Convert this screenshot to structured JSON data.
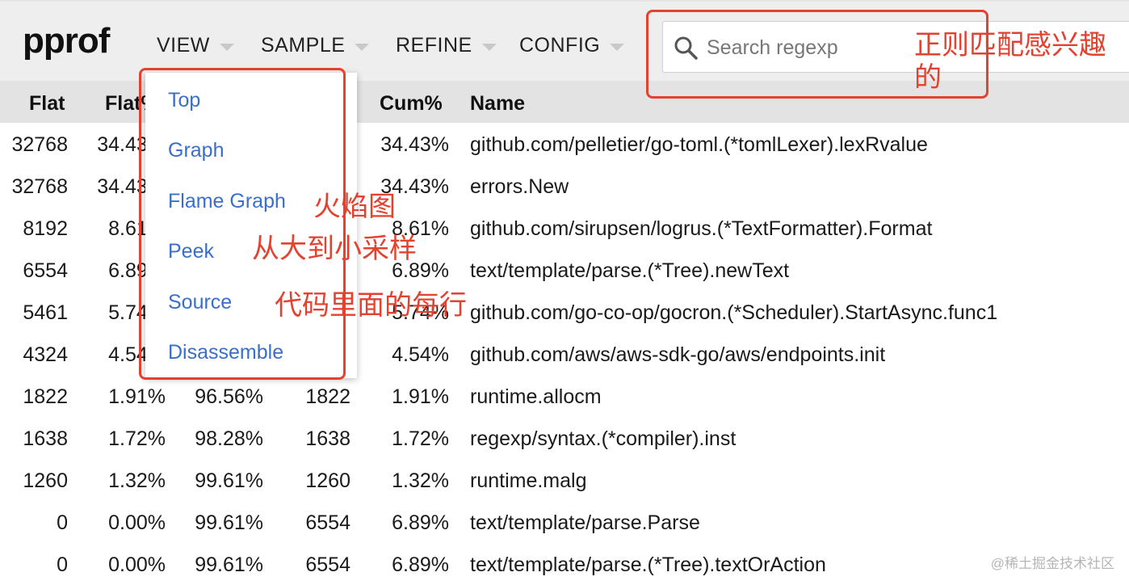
{
  "app": {
    "logo": "pprof"
  },
  "menus": [
    {
      "label": "VIEW"
    },
    {
      "label": "SAMPLE"
    },
    {
      "label": "REFINE"
    },
    {
      "label": "CONFIG"
    }
  ],
  "search": {
    "placeholder": "Search regexp",
    "value": ""
  },
  "table": {
    "headers": {
      "flat": "Flat",
      "flat_pct": "Flat%",
      "cum_pct": "Cum%",
      "name": "Name"
    },
    "rows": [
      {
        "flat": "32768",
        "flat_pct": "34.43%",
        "sum_pct": "",
        "cum": "",
        "cum_pct": "34.43%",
        "name": "github.com/pelletier/go-toml.(*tomlLexer).lexRvalue"
      },
      {
        "flat": "32768",
        "flat_pct": "34.43%",
        "sum_pct": "",
        "cum": "",
        "cum_pct": "34.43%",
        "name": "errors.New"
      },
      {
        "flat": "8192",
        "flat_pct": "8.61%",
        "sum_pct": "",
        "cum": "",
        "cum_pct": "8.61%",
        "name": "github.com/sirupsen/logrus.(*TextFormatter).Format"
      },
      {
        "flat": "6554",
        "flat_pct": "6.89%",
        "sum_pct": "",
        "cum": "",
        "cum_pct": "6.89%",
        "name": "text/template/parse.(*Tree).newText"
      },
      {
        "flat": "5461",
        "flat_pct": "5.74%",
        "sum_pct": "",
        "cum": "",
        "cum_pct": "5.74%",
        "name": "github.com/go-co-op/gocron.(*Scheduler).StartAsync.func1"
      },
      {
        "flat": "4324",
        "flat_pct": "4.54%",
        "sum_pct": "",
        "cum": "",
        "cum_pct": "4.54%",
        "name": "github.com/aws/aws-sdk-go/aws/endpoints.init"
      },
      {
        "flat": "1822",
        "flat_pct": "1.91%",
        "sum_pct": "96.56%",
        "cum": "1822",
        "cum_pct": "1.91%",
        "name": "runtime.allocm"
      },
      {
        "flat": "1638",
        "flat_pct": "1.72%",
        "sum_pct": "98.28%",
        "cum": "1638",
        "cum_pct": "1.72%",
        "name": "regexp/syntax.(*compiler).inst"
      },
      {
        "flat": "1260",
        "flat_pct": "1.32%",
        "sum_pct": "99.61%",
        "cum": "1260",
        "cum_pct": "1.32%",
        "name": "runtime.malg"
      },
      {
        "flat": "0",
        "flat_pct": "0.00%",
        "sum_pct": "99.61%",
        "cum": "6554",
        "cum_pct": "6.89%",
        "name": "text/template/parse.Parse"
      },
      {
        "flat": "0",
        "flat_pct": "0.00%",
        "sum_pct": "99.61%",
        "cum": "6554",
        "cum_pct": "6.89%",
        "name": "text/template/parse.(*Tree).textOrAction"
      }
    ]
  },
  "view_dropdown": {
    "items": [
      "Top",
      "Graph",
      "Flame Graph",
      "Peek",
      "Source",
      "Disassemble"
    ]
  },
  "annotations": {
    "search_note": "正则匹配感兴趣的",
    "flame_note": "火焰图",
    "peek_note": "从大到小采样",
    "source_note": "代码里面的每行"
  },
  "watermark": "@稀土掘金技术社区",
  "colors": {
    "link": "#3a6fc9",
    "annotation": "#e5412f",
    "header_bg": "#eeeeee",
    "thead_bg": "#e3e3e3"
  }
}
